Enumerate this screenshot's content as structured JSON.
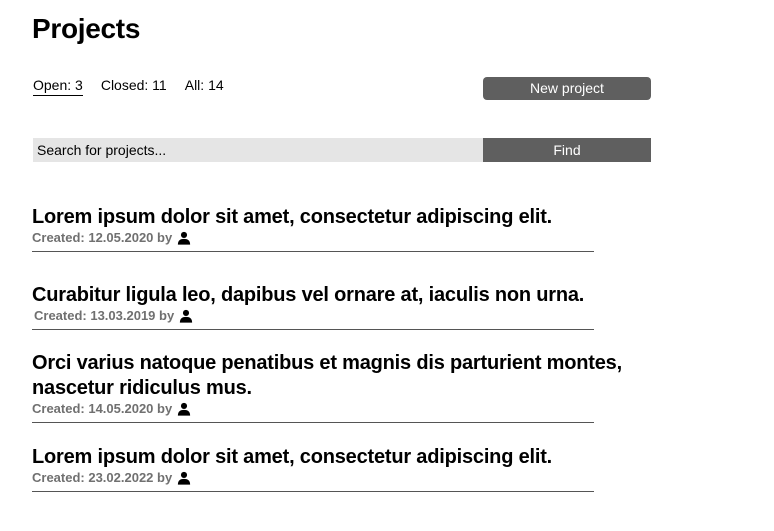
{
  "header": {
    "title": "Projects"
  },
  "filters": [
    {
      "label": "Open: 3",
      "active": true
    },
    {
      "label": "Closed: 11",
      "active": false
    },
    {
      "label": "All: 14",
      "active": false
    }
  ],
  "toolbar": {
    "new_project_label": "New project"
  },
  "search": {
    "placeholder": "Search for projects...",
    "find_label": "Find"
  },
  "projects": [
    {
      "title": "Lorem ipsum dolor sit amet, consectetur adipiscing elit.",
      "created": "Created: 12.05.2020 by"
    },
    {
      "title": "Curabitur ligula leo, dapibus vel ornare at, iaculis non urna.",
      "created": "Created: 13.03.2019 by"
    },
    {
      "title": "Orci varius natoque penatibus et magnis dis parturient montes, nascetur ridiculus mus.",
      "created": "Created: 14.05.2020 by"
    },
    {
      "title": "Lorem ipsum dolor sit amet, consectetur adipiscing elit.",
      "created": "Created: 23.02.2022 by"
    }
  ],
  "icons": {
    "author": "user-icon"
  }
}
